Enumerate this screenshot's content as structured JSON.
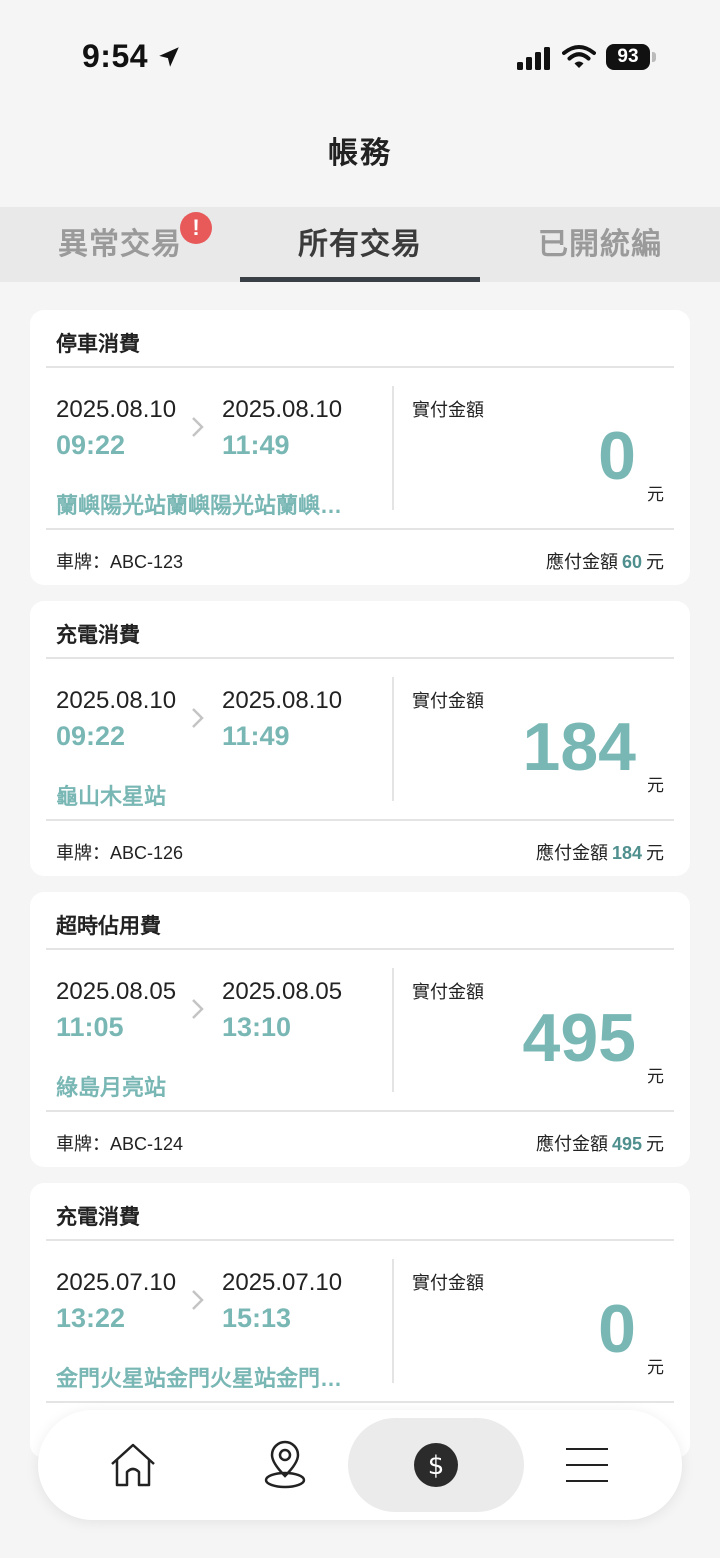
{
  "status_bar": {
    "time": "9:54",
    "battery": "93"
  },
  "page_title": "帳務",
  "tabs": [
    {
      "label": "異常交易",
      "has_alert": true,
      "alert": "!"
    },
    {
      "label": "所有交易",
      "active": true
    },
    {
      "label": "已開統編"
    }
  ],
  "cards": [
    {
      "type": "停車消費",
      "start_date": "2025.08.10",
      "start_time": "09:22",
      "end_date": "2025.08.10",
      "end_time": "11:49",
      "station": "蘭嶼陽光站蘭嶼陽光站蘭嶼…",
      "paid_label": "實付金額",
      "paid_amount": "0",
      "unit": "元",
      "plate": "車牌：ABC-123",
      "payable_label": "應付金額",
      "payable_amount": "60",
      "payable_unit": "元"
    },
    {
      "type": "充電消費",
      "start_date": "2025.08.10",
      "start_time": "09:22",
      "end_date": "2025.08.10",
      "end_time": "11:49",
      "station": "龜山木星站",
      "paid_label": "實付金額",
      "paid_amount": "184",
      "unit": "元",
      "plate": "車牌：ABC-126",
      "payable_label": "應付金額",
      "payable_amount": "184",
      "payable_unit": "元"
    },
    {
      "type": "超時佔用費",
      "start_date": "2025.08.05",
      "start_time": "11:05",
      "end_date": "2025.08.05",
      "end_time": "13:10",
      "station": "綠島月亮站",
      "paid_label": "實付金額",
      "paid_amount": "495",
      "unit": "元",
      "plate": "車牌：ABC-124",
      "payable_label": "應付金額",
      "payable_amount": "495",
      "payable_unit": "元"
    },
    {
      "type": "充電消費",
      "start_date": "2025.07.10",
      "start_time": "13:22",
      "end_date": "2025.07.10",
      "end_time": "15:13",
      "station": "金門火星站金門火星站金門…",
      "paid_label": "實付金額",
      "paid_amount": "0",
      "unit": "元"
    }
  ],
  "bottom_nav": [
    {
      "icon": "home-icon"
    },
    {
      "icon": "map-pin-icon"
    },
    {
      "icon": "dollar-icon",
      "active": true
    },
    {
      "icon": "menu-icon"
    }
  ],
  "colors": {
    "accent": "#79b7b5",
    "accent_dark": "#4f8f8e",
    "alert": "#e85a5a"
  }
}
